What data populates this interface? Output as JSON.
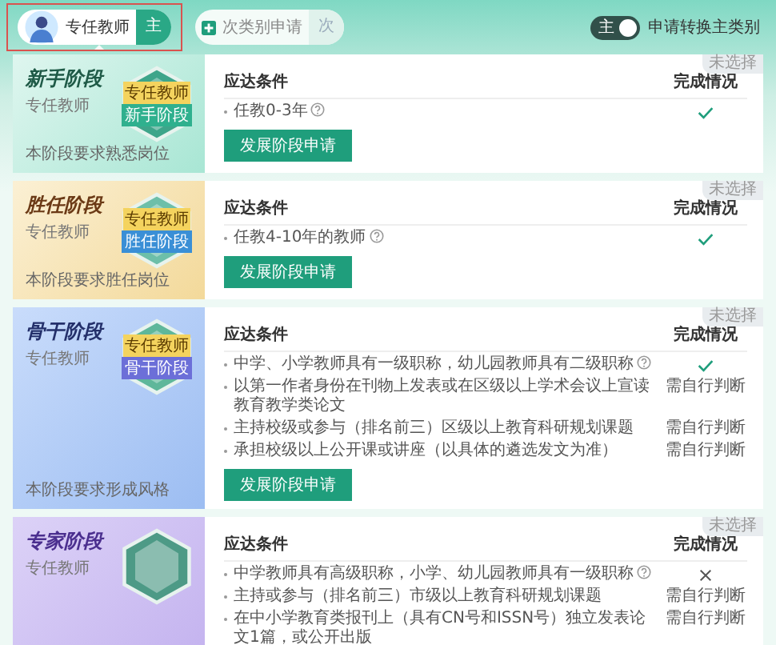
{
  "tabs": [
    {
      "kind": "main",
      "label": "专任教师",
      "pill": "主",
      "selected": true
    },
    {
      "kind": "add",
      "label": "次类别申请",
      "pill": "次",
      "selected": false
    }
  ],
  "switch": {
    "pill": "主",
    "label": "申请转换主类别",
    "on": true
  },
  "stages": [
    {
      "kind": "novice",
      "title": "新手阶段",
      "subtitle": "专任教师",
      "desc": "本阶段要求熟悉岗位",
      "badge_top": "专任教师",
      "badge_ribbon": "新手阶段",
      "tag": "未选择",
      "col_condition": "应达条件",
      "col_status": "完成情况",
      "button": "发展阶段申请",
      "conditions": [
        {
          "kind": "check",
          "text": "任教0-3年",
          "help": true
        }
      ]
    },
    {
      "kind": "competent",
      "title": "胜任阶段",
      "subtitle": "专任教师",
      "desc": "本阶段要求胜任岗位",
      "badge_top": "专任教师",
      "badge_ribbon": "胜任阶段",
      "tag": "未选择",
      "col_condition": "应达条件",
      "col_status": "完成情况",
      "button": "发展阶段申请",
      "conditions": [
        {
          "kind": "check",
          "text": "任教4-10年的教师",
          "help": true
        }
      ]
    },
    {
      "kind": "backbone",
      "title": "骨干阶段",
      "subtitle": "专任教师",
      "desc": "本阶段要求形成风格",
      "badge_top": "专任教师",
      "badge_ribbon": "骨干阶段",
      "tag": "未选择",
      "col_condition": "应达条件",
      "col_status": "完成情况",
      "button": "发展阶段申请",
      "conditions": [
        {
          "kind": "check",
          "text": "中学、小学教师具有一级职称，幼儿园教师具有二级职称",
          "help": true
        },
        {
          "kind": "text",
          "text": "以第一作者身份在刊物上发表或在区级以上学术会议上宣读教育教学类论文",
          "help": false,
          "status_text": "需自行判断"
        },
        {
          "kind": "text",
          "text": "主持校级或参与（排名前三）区级以上教育科研规划课题",
          "help": false,
          "status_text": "需自行判断"
        },
        {
          "kind": "text",
          "text": "承担校级以上公开课或讲座（以具体的遴选发文为准）",
          "help": false,
          "status_text": "需自行判断"
        }
      ]
    },
    {
      "kind": "expert",
      "title": "专家阶段",
      "subtitle": "专任教师",
      "tag": "未选择",
      "col_condition": "应达条件",
      "col_status": "完成情况",
      "conditions": [
        {
          "kind": "cross",
          "text": "中学教师具有高级职称，小学、幼儿园教师具有一级职称",
          "help": true
        },
        {
          "kind": "text",
          "text": "主持或参与（排名前三）市级以上教育科研规划课题",
          "help": false,
          "status_text": "需自行判断"
        },
        {
          "kind": "text",
          "text": "在中小学教育类报刊上（具有CN号和ISSN号）独立发表论文1篇，或公开出版",
          "help": false,
          "status_text": "需自行判断"
        }
      ]
    }
  ]
}
